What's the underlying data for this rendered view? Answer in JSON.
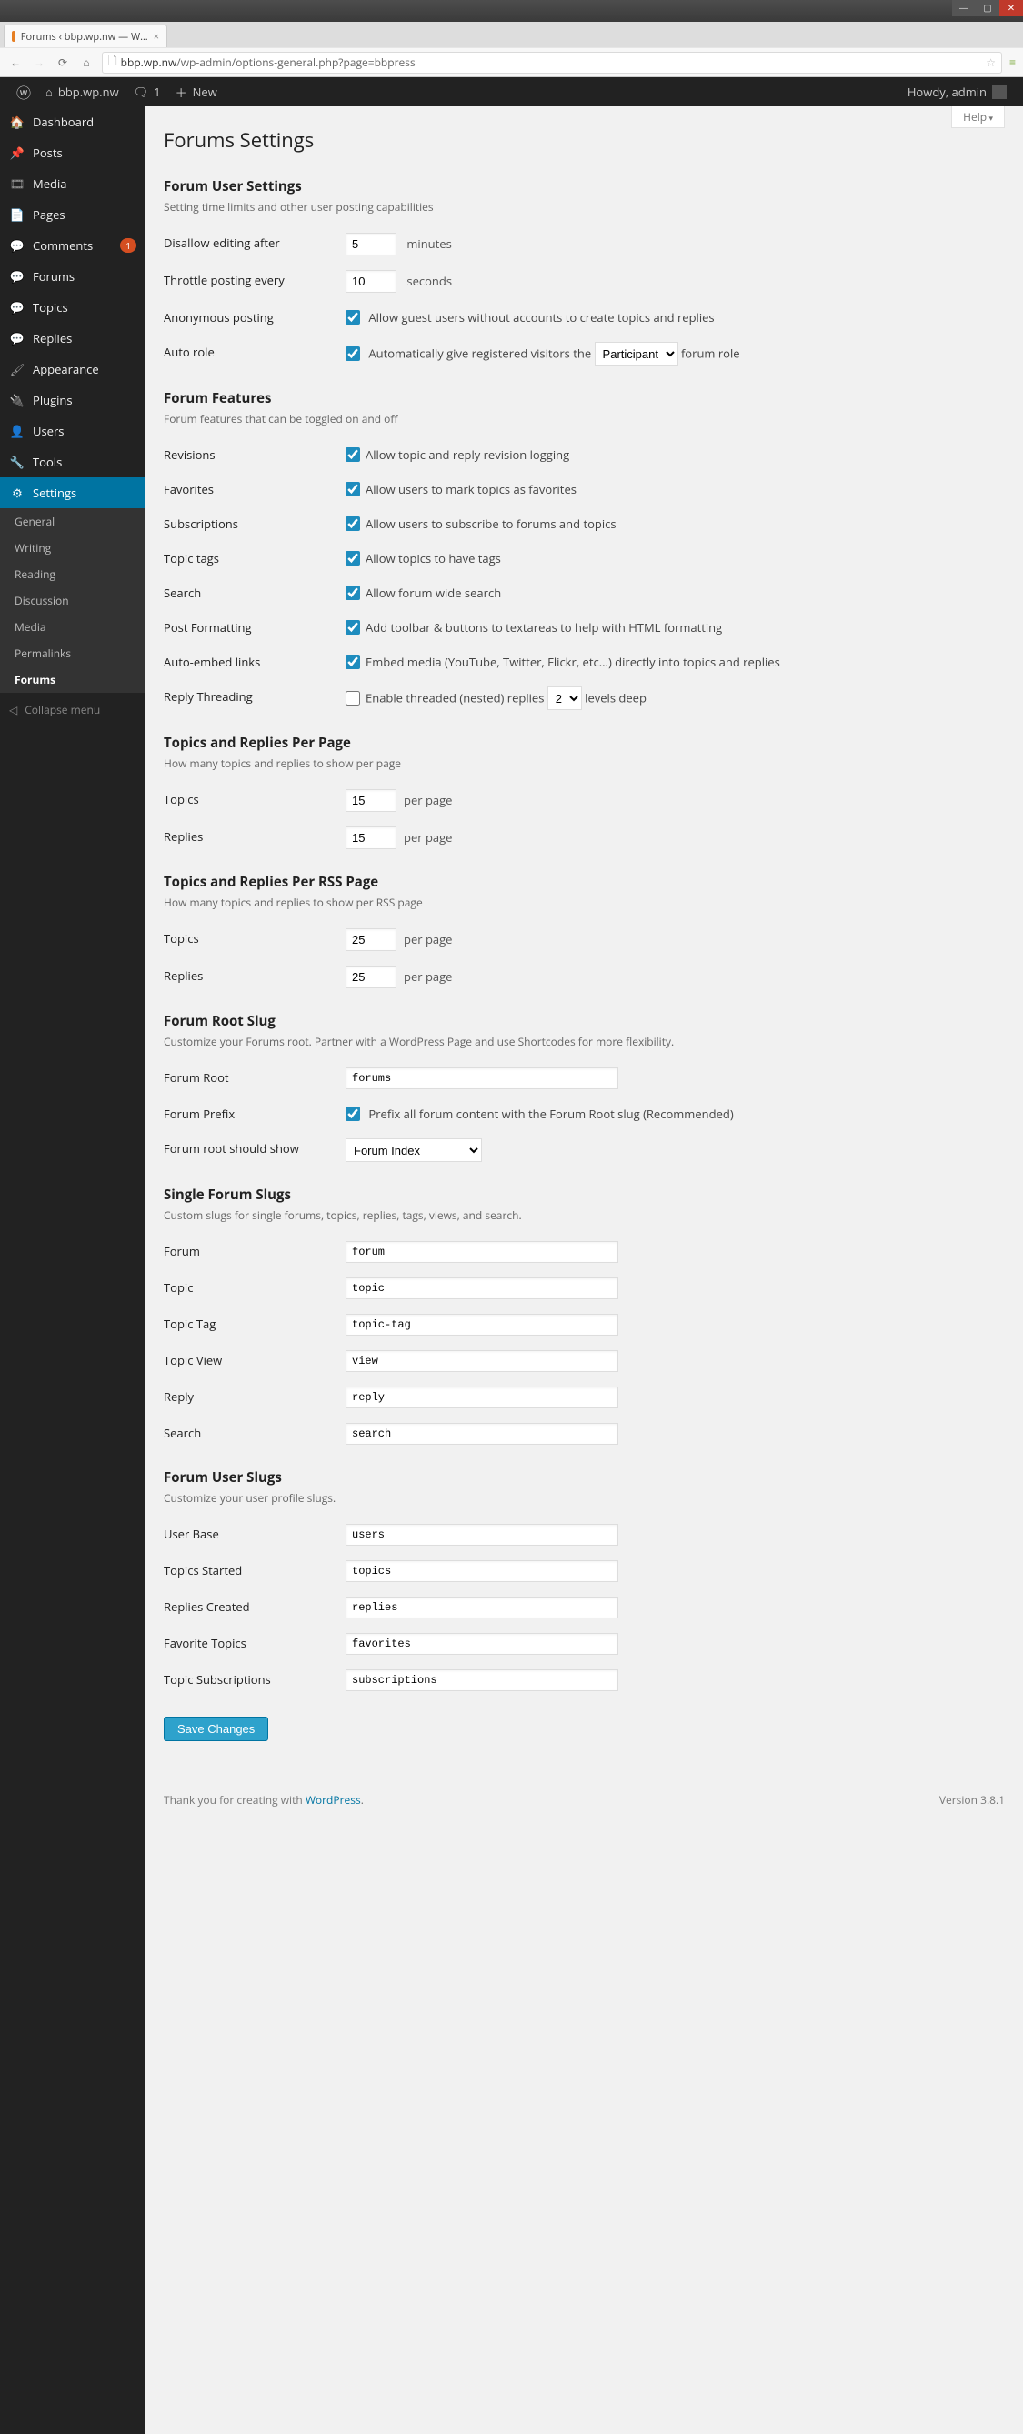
{
  "browser": {
    "tab_title": "Forums ‹ bbp.wp.nw — W…",
    "url_host": "bbp.wp.nw",
    "url_path": "/wp-admin/options-general.php?page=bbpress"
  },
  "adminbar": {
    "site_name": "bbp.wp.nw",
    "comment_count": "1",
    "new_label": "New",
    "howdy": "Howdy, admin"
  },
  "sidebar": {
    "items": [
      {
        "icon": "🏠",
        "label": "Dashboard"
      },
      {
        "icon": "📌",
        "label": "Posts"
      },
      {
        "icon": "🎞",
        "label": "Media"
      },
      {
        "icon": "📄",
        "label": "Pages"
      },
      {
        "icon": "💬",
        "label": "Comments",
        "badge": "1"
      },
      {
        "icon": "💬",
        "label": "Forums"
      },
      {
        "icon": "💬",
        "label": "Topics"
      },
      {
        "icon": "💬",
        "label": "Replies"
      },
      {
        "icon": "🖌",
        "label": "Appearance"
      },
      {
        "icon": "🔌",
        "label": "Plugins"
      },
      {
        "icon": "👤",
        "label": "Users"
      },
      {
        "icon": "🔧",
        "label": "Tools"
      },
      {
        "icon": "⚙",
        "label": "Settings",
        "current": true
      }
    ],
    "submenu": [
      {
        "label": "General"
      },
      {
        "label": "Writing"
      },
      {
        "label": "Reading"
      },
      {
        "label": "Discussion"
      },
      {
        "label": "Media"
      },
      {
        "label": "Permalinks"
      },
      {
        "label": "Forums",
        "current": true
      }
    ],
    "collapse_label": "Collapse menu"
  },
  "page": {
    "help_label": "Help",
    "title": "Forums Settings",
    "sections": {
      "user_settings": {
        "heading": "Forum User Settings",
        "desc": "Setting time limits and other user posting capabilities",
        "disallow_editing_label": "Disallow editing after",
        "disallow_editing_value": "5",
        "disallow_editing_unit": "minutes",
        "throttle_label": "Throttle posting every",
        "throttle_value": "10",
        "throttle_unit": "seconds",
        "anon_label": "Anonymous posting",
        "anon_text": "Allow guest users without accounts to create topics and replies",
        "anon_checked": true,
        "autorole_label": "Auto role",
        "autorole_text_pre": "Automatically give registered visitors the",
        "autorole_select": "Participant",
        "autorole_text_post": "forum role",
        "autorole_checked": true
      },
      "features": {
        "heading": "Forum Features",
        "desc": "Forum features that can be toggled on and off",
        "rows": [
          {
            "label": "Revisions",
            "checked": true,
            "text": "Allow topic and reply revision logging"
          },
          {
            "label": "Favorites",
            "checked": true,
            "text": "Allow users to mark topics as favorites"
          },
          {
            "label": "Subscriptions",
            "checked": true,
            "text": "Allow users to subscribe to forums and topics"
          },
          {
            "label": "Topic tags",
            "checked": true,
            "text": "Allow topics to have tags"
          },
          {
            "label": "Search",
            "checked": true,
            "text": "Allow forum wide search"
          },
          {
            "label": "Post Formatting",
            "checked": true,
            "text": "Add toolbar & buttons to textareas to help with HTML formatting"
          },
          {
            "label": "Auto-embed links",
            "checked": true,
            "text": "Embed media (YouTube, Twitter, Flickr, etc...) directly into topics and replies"
          }
        ],
        "reply_threading_label": "Reply Threading",
        "reply_threading_checked": false,
        "reply_threading_pre": "Enable threaded (nested) replies",
        "reply_threading_select": "2",
        "reply_threading_post": "levels deep"
      },
      "per_page": {
        "heading": "Topics and Replies Per Page",
        "desc": "How many topics and replies to show per page",
        "topics_label": "Topics",
        "topics_value": "15",
        "unit": "per page",
        "replies_label": "Replies",
        "replies_value": "15"
      },
      "per_rss": {
        "heading": "Topics and Replies Per RSS Page",
        "desc": "How many topics and replies to show per RSS page",
        "topics_label": "Topics",
        "topics_value": "25",
        "unit": "per page",
        "replies_label": "Replies",
        "replies_value": "25"
      },
      "root_slug": {
        "heading": "Forum Root Slug",
        "desc": "Customize your Forums root. Partner with a WordPress Page and use Shortcodes for more flexibility.",
        "root_label": "Forum Root",
        "root_value": "forums",
        "prefix_label": "Forum Prefix",
        "prefix_checked": true,
        "prefix_text": "Prefix all forum content with the Forum Root slug (Recommended)",
        "show_label": "Forum root should show",
        "show_value": "Forum Index"
      },
      "single_slugs": {
        "heading": "Single Forum Slugs",
        "desc": "Custom slugs for single forums, topics, replies, tags, views, and search.",
        "rows": [
          {
            "label": "Forum",
            "value": "forum"
          },
          {
            "label": "Topic",
            "value": "topic"
          },
          {
            "label": "Topic Tag",
            "value": "topic-tag"
          },
          {
            "label": "Topic View",
            "value": "view"
          },
          {
            "label": "Reply",
            "value": "reply"
          },
          {
            "label": "Search",
            "value": "search"
          }
        ]
      },
      "user_slugs": {
        "heading": "Forum User Slugs",
        "desc": "Customize your user profile slugs.",
        "rows": [
          {
            "label": "User Base",
            "value": "users"
          },
          {
            "label": "Topics Started",
            "value": "topics"
          },
          {
            "label": "Replies Created",
            "value": "replies"
          },
          {
            "label": "Favorite Topics",
            "value": "favorites"
          },
          {
            "label": "Topic Subscriptions",
            "value": "subscriptions"
          }
        ]
      }
    },
    "save_label": "Save Changes",
    "footer_thank": "Thank you for creating with ",
    "footer_wp": "WordPress",
    "footer_period": ".",
    "footer_version": "Version 3.8.1"
  }
}
